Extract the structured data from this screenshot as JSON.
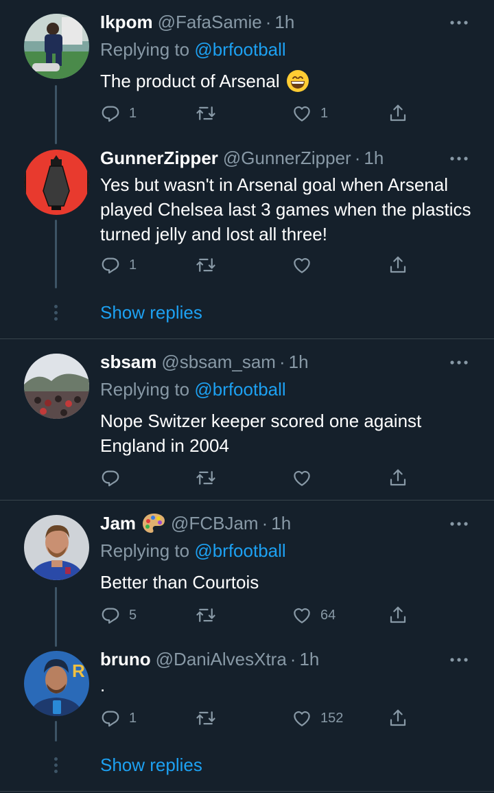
{
  "tweets": [
    {
      "name": "Ikpom",
      "handle": "@FafaSamie",
      "dot": "·",
      "time": "1h",
      "replying_prefix": "Replying to",
      "replying_to": "@brfootball",
      "text": "The product of Arsenal",
      "emoji": "grinning-face-emoji",
      "reply_count": "1",
      "retweet_count": "",
      "like_count": "1",
      "avatar": "player-photo-avatar"
    },
    {
      "name": "GunnerZipper",
      "handle": "@GunnerZipper",
      "dot": "·",
      "time": "1h",
      "text": "Yes but wasn't in Arsenal goal when Arsenal played Chelsea last 3 games when the plastics turned jelly and lost all three!",
      "reply_count": "1",
      "retweet_count": "",
      "like_count": "",
      "avatar": "cannon-logo-avatar"
    },
    {
      "name": "sbsam",
      "handle": "@sbsam_sam",
      "dot": "·",
      "time": "1h",
      "replying_prefix": "Replying to",
      "replying_to": "@brfootball",
      "text": "Nope Switzer keeper scored one against England in 2004",
      "reply_count": "",
      "retweet_count": "",
      "like_count": "",
      "avatar": "crowd-photo-avatar"
    },
    {
      "name": "Jam",
      "name_emoji": "artist-palette-emoji",
      "handle": "@FCBJam",
      "dot": "·",
      "time": "1h",
      "replying_prefix": "Replying to",
      "replying_to": "@brfootball",
      "text": "Better than Courtois",
      "reply_count": "5",
      "retweet_count": "",
      "like_count": "64",
      "avatar": "player-portrait-avatar"
    },
    {
      "name": "bruno",
      "handle": "@DaniAlvesXtra",
      "dot": "·",
      "time": "1h",
      "text": ".",
      "reply_count": "1",
      "retweet_count": "",
      "like_count": "152",
      "avatar": "player-portrait-avatar"
    }
  ],
  "show_replies_label": "Show replies",
  "icons": [
    "reply-icon",
    "retweet-icon",
    "like-icon",
    "share-icon",
    "more-options-icon"
  ],
  "colors": {
    "background": "#15202b",
    "text_primary": "#ffffff",
    "text_secondary": "#8899a6",
    "accent": "#1da1f2",
    "divider": "#38444d",
    "thread_line": "#3d5466"
  }
}
